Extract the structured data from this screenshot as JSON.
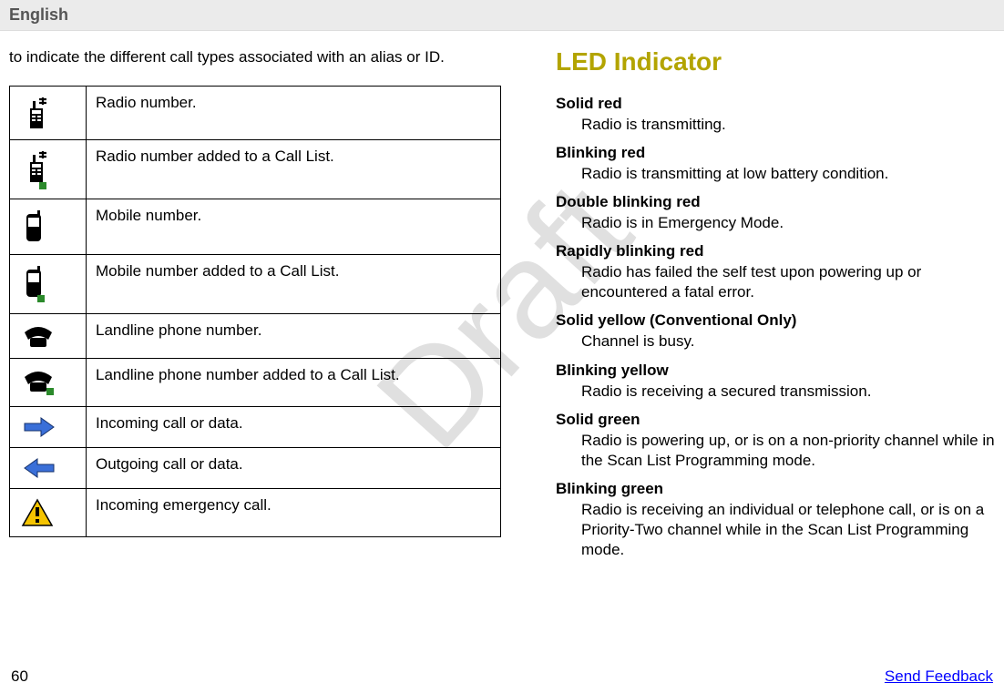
{
  "header": {
    "language": "English"
  },
  "leftColumn": {
    "intro": "to indicate the different call types associated with an alias or ID.",
    "rows": [
      {
        "icon": "radio-number-icon",
        "desc": "Radio number."
      },
      {
        "icon": "radio-number-list-icon",
        "desc": "Radio number added to a Call List."
      },
      {
        "icon": "mobile-number-icon",
        "desc": "Mobile number."
      },
      {
        "icon": "mobile-number-list-icon",
        "desc": "Mobile number added to a Call List."
      },
      {
        "icon": "landline-icon",
        "desc": "Landline phone number."
      },
      {
        "icon": "landline-list-icon",
        "desc": "Landline phone number added to a Call List."
      },
      {
        "icon": "incoming-arrow-icon",
        "desc": "Incoming call or data."
      },
      {
        "icon": "outgoing-arrow-icon",
        "desc": "Outgoing call or data."
      },
      {
        "icon": "emergency-icon",
        "desc": "Incoming emergency call."
      }
    ]
  },
  "rightColumn": {
    "title": "LED Indicator",
    "items": [
      {
        "term": "Solid red",
        "def": "Radio is transmitting."
      },
      {
        "term": "Blinking red",
        "def": "Radio is transmitting at low battery condition."
      },
      {
        "term": "Double blinking red",
        "def": "Radio is in Emergency Mode."
      },
      {
        "term": "Rapidly blinking red",
        "def": "Radio has failed the self test upon powering up or encountered a fatal error."
      },
      {
        "term": "Solid yellow (Conventional Only)",
        "def": "Channel is busy."
      },
      {
        "term": "Blinking yellow",
        "def": "Radio is receiving a secured transmission."
      },
      {
        "term": "Solid green",
        "def": "Radio is powering up, or is on a non-priority channel while in the Scan List Programming mode."
      },
      {
        "term": "Blinking green",
        "def": "Radio is receiving an individual or telephone call, or is on a Priority-Two channel while in the Scan List Programming mode."
      }
    ]
  },
  "footer": {
    "page": "60",
    "feedback": "Send Feedback"
  },
  "watermark": "Draft"
}
